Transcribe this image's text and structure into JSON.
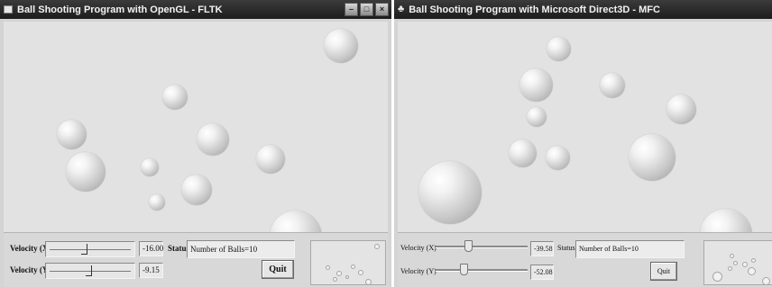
{
  "left_window": {
    "title": "Ball Shooting Program with OpenGL - FLTK",
    "icon": "window-app-icon",
    "window_buttons": [
      "minimize-icon",
      "maximize-icon",
      "close-icon"
    ],
    "controls": {
      "velocity_x": {
        "label": "Velocity (X)",
        "value": "-16.00",
        "slider_fraction": 0.42
      },
      "velocity_y": {
        "label": "Velocity (Y)",
        "value": "-9.15",
        "slider_fraction": 0.48
      },
      "status_label": "Status",
      "status_value": "Number of Balls=10",
      "quit_label": "Quit"
    }
  },
  "right_window": {
    "title": "Ball Shooting Program with Microsoft Direct3D - MFC",
    "icon": "window-app-icon",
    "controls": {
      "velocity_x": {
        "label": "Velocity (X)",
        "value": "-39.58",
        "slider_fraction": 0.33
      },
      "velocity_y": {
        "label": "Velocity (Y)",
        "value": "-52.08",
        "slider_fraction": 0.27
      },
      "status_label": "Status",
      "status_value": "Number of Balls=10",
      "quit_label": "Quit"
    }
  },
  "colors": {
    "titlebar": "#2a2a2a",
    "viewport_background": "#e2e2e2",
    "panel_background": "#d8d8d8"
  }
}
